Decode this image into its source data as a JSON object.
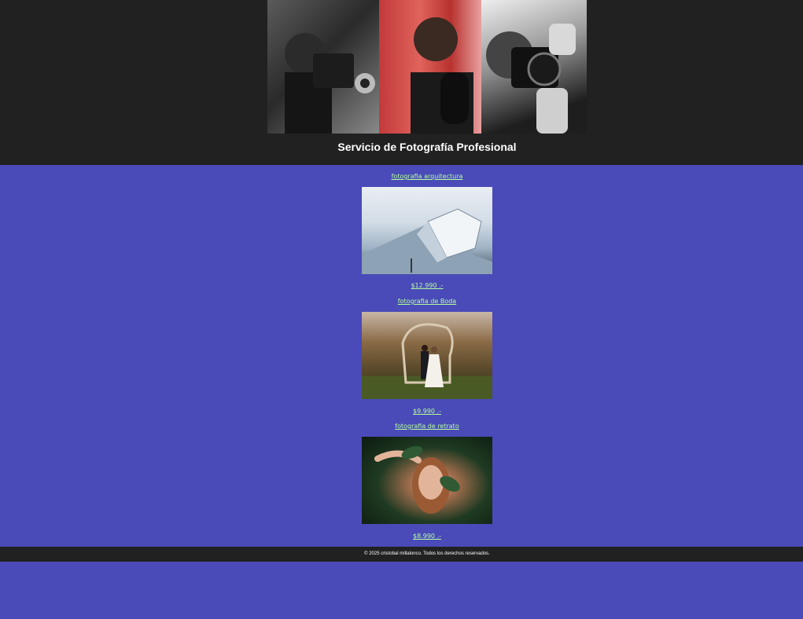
{
  "header": {
    "title": "Servicio de Fotografía Profesional"
  },
  "services": [
    {
      "name": "fotografia arquitectura",
      "price": "$12.990 .-"
    },
    {
      "name": "fotografia de Boda",
      "price": "$9.990 .-"
    },
    {
      "name": "fotografia de retrato",
      "price": "$8.990 .-"
    }
  ],
  "footer": {
    "text": "© 2025 cristobal millalonco. Todos los derechos reservados."
  },
  "colors": {
    "page_background": "#4a4ab8",
    "header_background": "#212121",
    "link_color": "#b4ff9e"
  }
}
